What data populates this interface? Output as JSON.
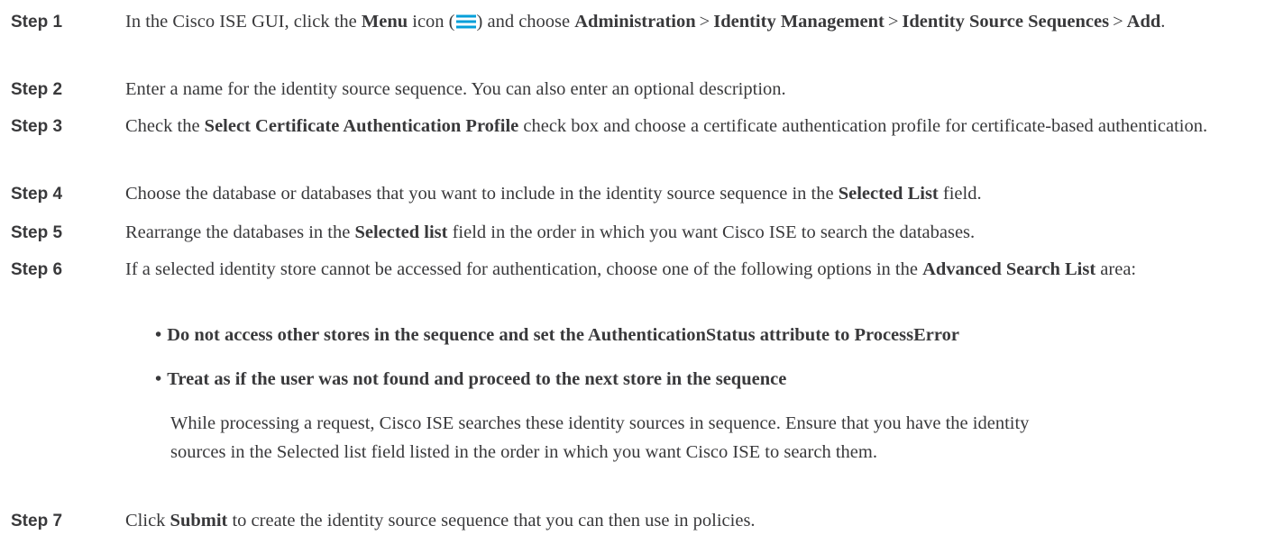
{
  "steps": [
    {
      "label": "Step 1",
      "parts": {
        "a": "In the Cisco ISE GUI, click the ",
        "b_menu": "Menu",
        "c": " icon (",
        "d": ") and choose ",
        "e_admin": "Administration",
        "gt1": ">",
        "f_idm": "Identity Management",
        "gt2": ">",
        "g_iss": "Identity Source Sequences",
        "gt3": ">",
        "h_add": "Add",
        "end": "."
      }
    },
    {
      "label": "Step 2",
      "text": "Enter a name for the identity source sequence. You can also enter an optional description."
    },
    {
      "label": "Step 3",
      "parts": {
        "a": "Check the ",
        "b": "Select Certificate Authentication Profile",
        "c": " check box and choose a certificate authentication profile for certificate-based authentication."
      }
    },
    {
      "label": "Step 4",
      "parts": {
        "a": "Choose the database or databases that you want to include in the identity source sequence in the ",
        "b": "Selected List",
        "c": " field."
      }
    },
    {
      "label": "Step 5",
      "parts": {
        "a": "Rearrange the databases in the ",
        "b": "Selected list",
        "c": " field in the order in which you want Cisco ISE to search the databases."
      }
    },
    {
      "label": "Step 6",
      "parts": {
        "a": "If a selected identity store cannot be accessed for authentication, choose one of the following options in the ",
        "b": "Advanced Search List",
        "c": " area:"
      },
      "options": [
        "Do not access other stores in the sequence and set the AuthenticationStatus attribute to ProcessError",
        "Treat as if the user was not found and proceed to the next store in the sequence"
      ],
      "note_line1": "While processing a request, Cisco ISE searches these identity sources in sequence. Ensure that you have the identity",
      "note_line2": "sources in the Selected list field listed in the order in which you want Cisco ISE to search them."
    },
    {
      "label": "Step 7",
      "parts": {
        "a": "Click ",
        "b": "Submit",
        "c": " to create the identity source sequence that you can then use in policies."
      }
    }
  ],
  "bullet_char": "•",
  "colors": {
    "text": "#39393b",
    "menu_icon": "#049fd9"
  },
  "icons": {
    "menu": "hamburger-menu-icon"
  }
}
